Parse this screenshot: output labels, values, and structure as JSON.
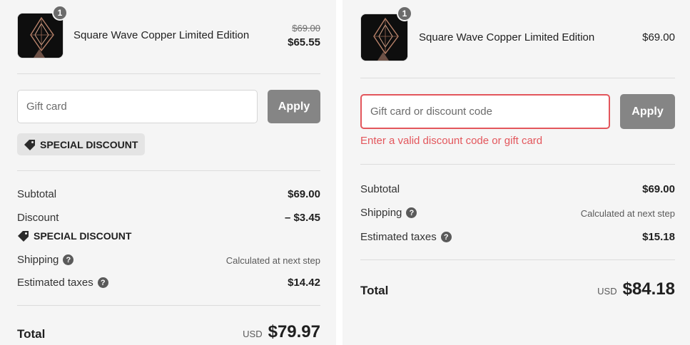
{
  "left": {
    "product": {
      "quantity": "1",
      "name": "Square Wave Copper Limited Edition",
      "original_price": "$69.00",
      "price": "$65.55"
    },
    "discount_input": {
      "placeholder": "Gift card"
    },
    "apply_label": "Apply",
    "applied_discount": {
      "icon": "tag-icon",
      "label": "SPECIAL DISCOUNT"
    },
    "summary": {
      "subtotal_label": "Subtotal",
      "subtotal_value": "$69.00",
      "discount_label": "Discount",
      "discount_value": "– $3.45",
      "discount_code": "SPECIAL DISCOUNT",
      "shipping_label": "Shipping",
      "shipping_value": "Calculated at next step",
      "taxes_label": "Estimated taxes",
      "taxes_value": "$14.42"
    },
    "total": {
      "label": "Total",
      "currency": "USD",
      "value": "$79.97"
    }
  },
  "right": {
    "product": {
      "quantity": "1",
      "name": "Square Wave Copper Limited Edition",
      "price": "$69.00"
    },
    "discount_input": {
      "placeholder": "Gift card or discount code"
    },
    "apply_label": "Apply",
    "error_message": "Enter a valid discount code or gift card",
    "summary": {
      "subtotal_label": "Subtotal",
      "subtotal_value": "$69.00",
      "shipping_label": "Shipping",
      "shipping_value": "Calculated at next step",
      "taxes_label": "Estimated taxes",
      "taxes_value": "$15.18"
    },
    "total": {
      "label": "Total",
      "currency": "USD",
      "value": "$84.18"
    }
  },
  "help_icon_glyph": "?",
  "colors": {
    "panel_bg": "#f5f5f5",
    "button_bg": "#858585",
    "error": "#e3565c",
    "chip_bg": "#e4e4e4"
  }
}
